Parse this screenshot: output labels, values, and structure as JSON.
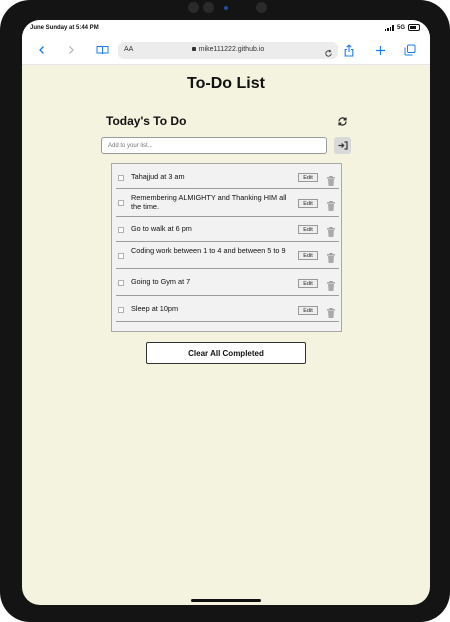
{
  "status": {
    "time": "June Sunday at 5:44 PM",
    "network": "5G"
  },
  "browser": {
    "text_size": "AA",
    "url": "mike111222.github.io"
  },
  "app": {
    "title": "To-Do List",
    "section_title": "Today's To Do",
    "input_placeholder": "Add to your list...",
    "items": [
      {
        "text": "Tahajjud at 3 am",
        "edit": "Edit"
      },
      {
        "text": "Remembering ALMIGHTY and Thanking HIM all the time.",
        "edit": "Edit"
      },
      {
        "text": "Go to walk at 6 pm",
        "edit": "Edit"
      },
      {
        "text": "Coding work between 1 to 4 and between 5 to 9",
        "edit": "Edit"
      },
      {
        "text": "Going to Gym at 7",
        "edit": "Edit"
      },
      {
        "text": "Sleep at 10pm",
        "edit": "Edit"
      }
    ],
    "clear_label": "Clear All Completed"
  },
  "colors": {
    "page_bg": "#f4f3df",
    "browser_blue": "#1a7cf0",
    "list_bg": "#f2f2f2"
  }
}
